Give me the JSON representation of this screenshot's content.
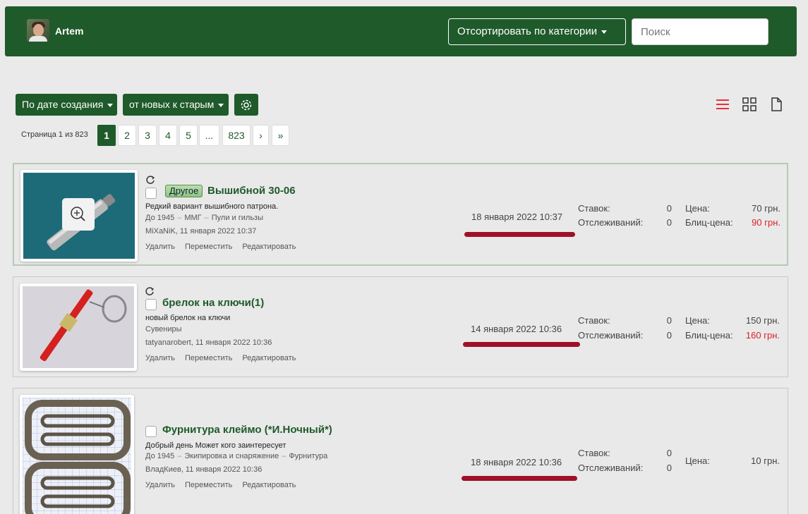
{
  "header": {
    "username": "Artem",
    "sort_category_label": "Отсортировать по категории",
    "search_placeholder": "Поиск"
  },
  "toolbar": {
    "sort_by_label": "По дате создания",
    "order_label": "от новых к старым",
    "settings_icon": "gear-icon",
    "view_icons": [
      "list-view-icon",
      "grid-view-icon",
      "document-view-icon"
    ],
    "accent_color": "#e8303a"
  },
  "pagination": {
    "info": "Страница 1 из 823",
    "pages": [
      "1",
      "2",
      "3",
      "4",
      "5",
      "...",
      "823",
      "›",
      "»"
    ],
    "current": "1"
  },
  "listings": [
    {
      "tag": "Другое",
      "title": "Вышибной 30-06",
      "description": "Редкий вариант вышибного патрона.",
      "category": [
        "До 1945",
        "ММГ",
        "Пули и гильзы"
      ],
      "author": "MiXaNiK",
      "created": ", 11 января 2022 10:37",
      "actions": [
        "Удалить",
        "Переместить",
        "Редактировать"
      ],
      "end_date": "18 января 2022 10:37",
      "bids_label": "Ставок:",
      "bids": "0",
      "watchers_label": "Отслеживаний:",
      "watchers": "0",
      "price_label": "Цена:",
      "price": "70 грн.",
      "blitz_label": "Блиц-цена:",
      "blitz_price": "90 грн."
    },
    {
      "tag": "",
      "title": "брелок на ключи(1)",
      "description": "новый брелок на ключи",
      "category": [
        "Сувениры"
      ],
      "author": "tatyanarobert",
      "created": ", 11 января 2022 10:36",
      "actions": [
        "Удалить",
        "Переместить",
        "Редактировать"
      ],
      "end_date": "14 января 2022 10:36",
      "bids_label": "Ставок:",
      "bids": "0",
      "watchers_label": "Отслеживаний:",
      "watchers": "0",
      "price_label": "Цена:",
      "price": "150 грн.",
      "blitz_label": "Блиц-цена:",
      "blitz_price": "160 грн."
    },
    {
      "tag": "",
      "title": "Фурнитура клеймо (*И.Ночный*)",
      "description": "Добрый день Может кого заинтересует",
      "category": [
        "До 1945",
        "Экипировка и снаряжение",
        "Фурнитура"
      ],
      "author": "ВладКиев",
      "created": ", 11 января 2022 10:36",
      "actions": [
        "Удалить",
        "Переместить",
        "Редактировать"
      ],
      "end_date": "18 января 2022 10:36",
      "bids_label": "Ставок:",
      "bids": "0",
      "watchers_label": "Отслеживаний:",
      "watchers": "0",
      "price_label": "Цена:",
      "price": "10 грн."
    }
  ]
}
